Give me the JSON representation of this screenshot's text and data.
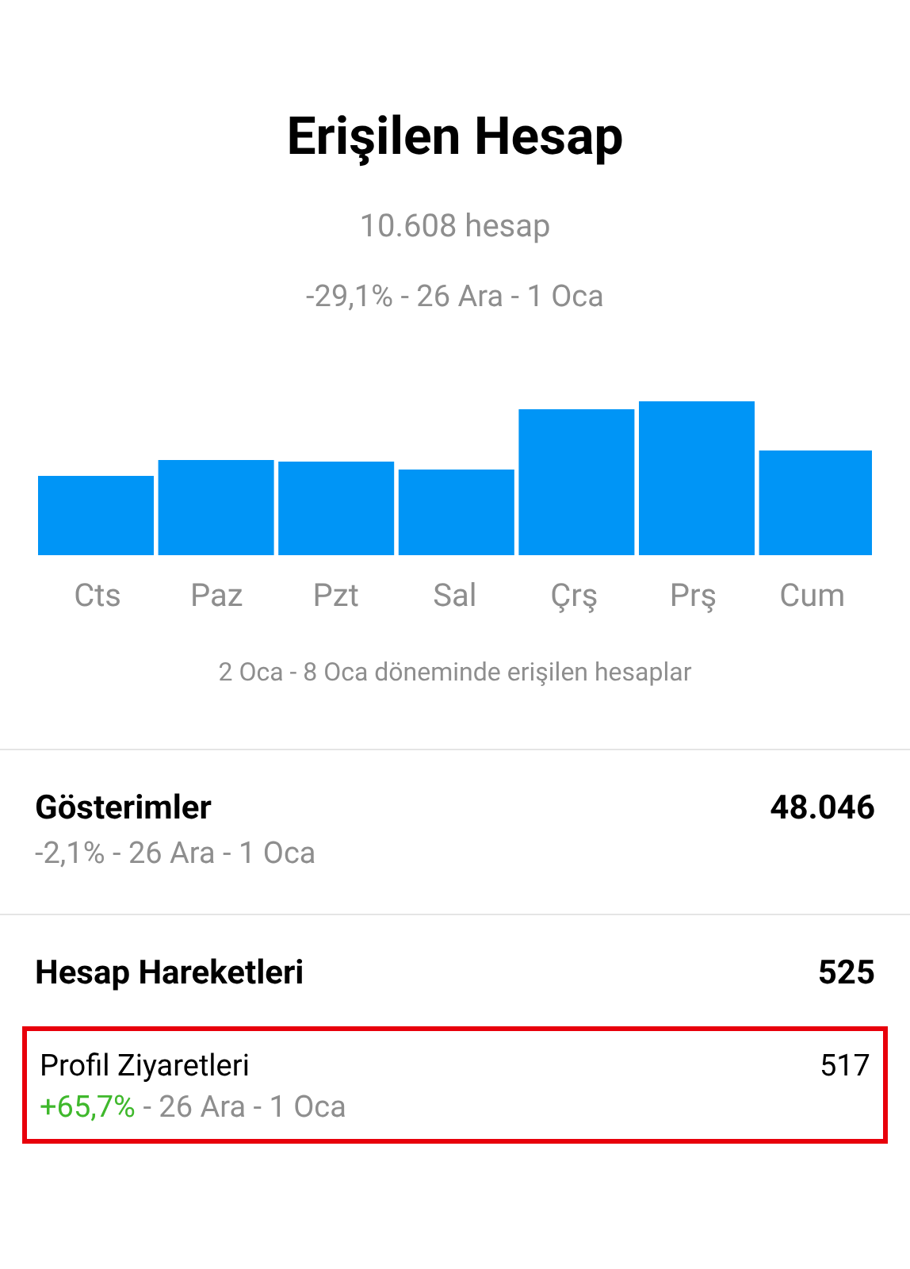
{
  "header": {
    "title": "Erişilen Hesap",
    "count": "10.608 hesap",
    "comparison": "-29,1% - 26 Ara - 1 Oca"
  },
  "chart": {
    "days": [
      "Cts",
      "Paz",
      "Pzt",
      "Sal",
      "Çrş",
      "Prş",
      "Cum"
    ],
    "caption": "2 Oca - 8 Oca döneminde erişilen hesaplar"
  },
  "sections": [
    {
      "title": "Gösterimler",
      "value": "48.046",
      "change": "-2,1%",
      "positive": false,
      "period": " - 26 Ara - 1 Oca"
    },
    {
      "title": "Hesap Hareketleri",
      "value": "525",
      "items": [
        {
          "title": "Profil Ziyaretleri",
          "value": "517",
          "change": "+65,7%",
          "positive": true,
          "period": " - 26 Ara - 1 Oca",
          "highlighted": true
        }
      ]
    }
  ]
}
